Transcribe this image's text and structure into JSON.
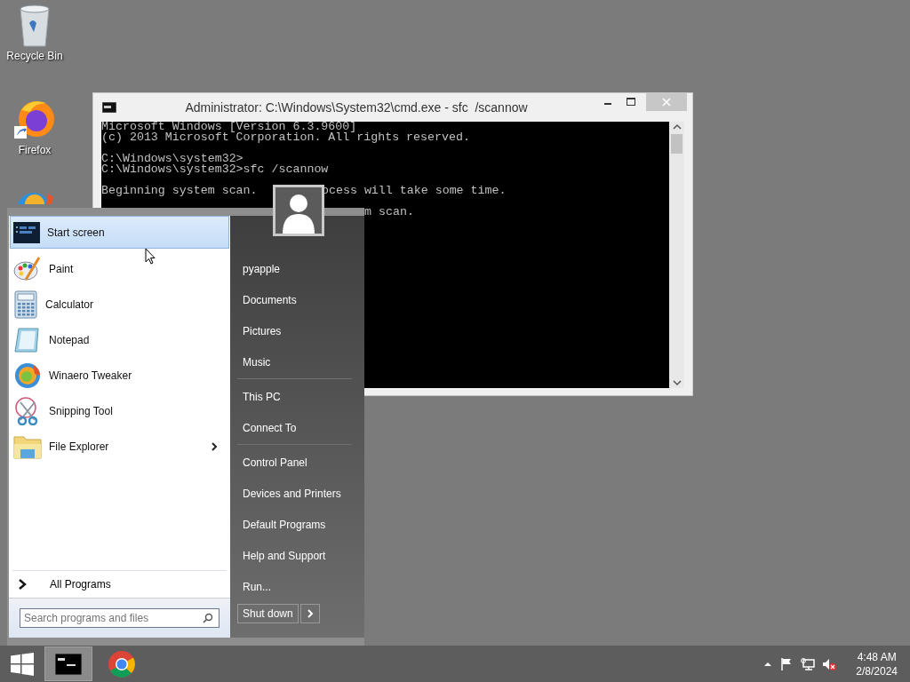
{
  "desktop_icons": [
    {
      "label": "Recycle Bin",
      "kind": "recycle-bin"
    },
    {
      "label": "Firefox",
      "kind": "firefox"
    },
    {
      "kind": "browser"
    }
  ],
  "console_window": {
    "title": "Administrator: C:\\Windows\\System32\\cmd.exe - sfc  /scannow",
    "lines": [
      "Microsoft Windows [Version 6.3.9600]",
      "(c) 2013 Microsoft Corporation. All rights reserved.",
      "C:\\Windows\\system32>",
      "C:\\Windows\\system32>sfc /scannow",
      "Beginning system scan.",
      "ocess will take some time.",
      "m scan."
    ]
  },
  "start_menu": {
    "pinned": [
      {
        "label": "Start screen",
        "kind": "start-screen",
        "selected": true,
        "submenu": false
      },
      {
        "label": "Paint",
        "kind": "paint",
        "selected": false,
        "submenu": false
      },
      {
        "label": "Calculator",
        "kind": "calculator",
        "selected": false,
        "submenu": false
      },
      {
        "label": "Notepad",
        "kind": "notepad",
        "selected": false,
        "submenu": false
      },
      {
        "label": "Winaero Tweaker",
        "kind": "tweaker",
        "selected": false,
        "submenu": false
      },
      {
        "label": "Snipping Tool",
        "kind": "snipping",
        "selected": false,
        "submenu": false
      },
      {
        "label": "File Explorer",
        "kind": "explorer",
        "selected": false,
        "submenu": true
      }
    ],
    "all_programs": "All Programs",
    "search": {
      "placeholder": "Search programs and files"
    },
    "places": [
      [
        "pyapple",
        "Documents",
        "Pictures",
        "Music"
      ],
      [
        "This PC",
        "Connect To"
      ],
      [
        "Control Panel",
        "Devices and Printers",
        "Default Programs",
        "Help and Support",
        "Run..."
      ]
    ],
    "shutdown": "Shut down"
  },
  "taskbar": {
    "buttons": [
      {
        "kind": "cmd",
        "selected": true
      },
      {
        "kind": "chrome",
        "selected": false
      }
    ],
    "time": "4:48 AM",
    "date": "2/8/2024"
  }
}
